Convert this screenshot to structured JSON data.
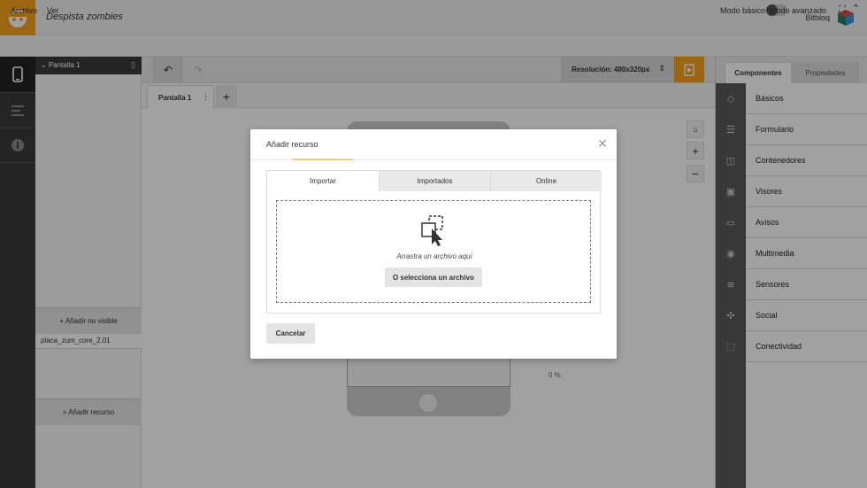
{
  "header": {
    "project_title": "Despista zombies",
    "brand": "Bitbloq"
  },
  "menu": {
    "items": [
      "Archivo",
      "Ver"
    ],
    "mode_basic": "Modo básico",
    "mode_advanced": "Modo avanzado"
  },
  "tree": {
    "screen_name": "Pantalla 1",
    "add_nonvisible": "+ Añadir no visible",
    "asset_name": "placa_zum_core_2.01",
    "add_resource": "+ Añadir recurso"
  },
  "toolbar": {
    "resolution": "Resolución: 480x320px"
  },
  "tabs": {
    "screen1": "Pantalla 1"
  },
  "canvas": {
    "progress": "0 %"
  },
  "right_panel": {
    "tab_components": "Componentes",
    "tab_properties": "Propiedades",
    "categories": [
      "Básicos",
      "Formulario",
      "Contenedores",
      "Visores",
      "Avisos",
      "Multimedia",
      "Sensores",
      "Social",
      "Conectividad"
    ]
  },
  "modal": {
    "title": "Añadir recurso",
    "tabs": [
      "Importar",
      "Importados",
      "Online"
    ],
    "drop_text": "Arrastra un archivo aquí",
    "select_button": "O selecciona un archivo",
    "cancel_button": "Cancelar"
  },
  "colors": {
    "accent": "#f7a21b",
    "dark": "#3a3a3a"
  }
}
